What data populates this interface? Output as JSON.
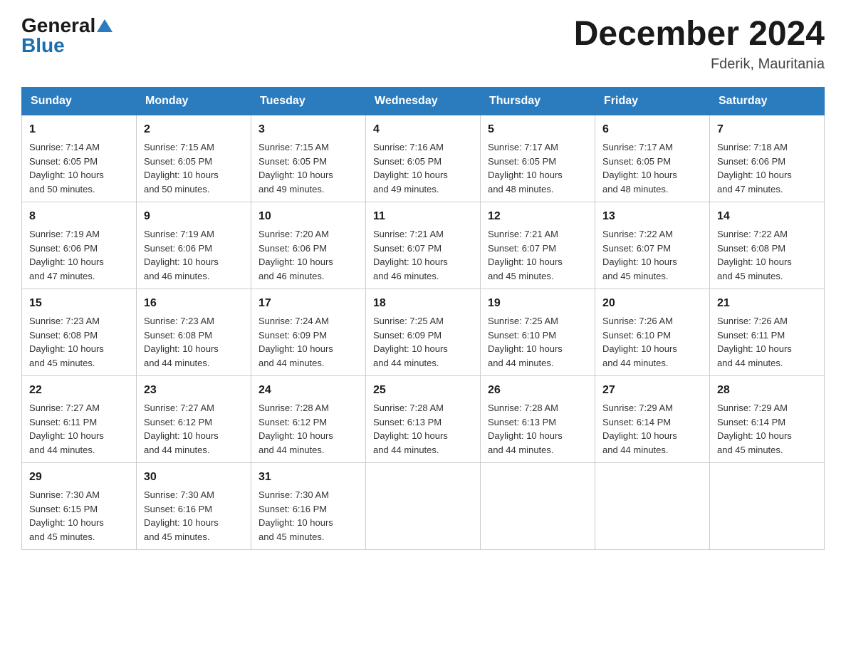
{
  "header": {
    "logo_general": "General",
    "logo_blue": "Blue",
    "month_title": "December 2024",
    "location": "Fderik, Mauritania"
  },
  "days_of_week": [
    "Sunday",
    "Monday",
    "Tuesday",
    "Wednesday",
    "Thursday",
    "Friday",
    "Saturday"
  ],
  "weeks": [
    [
      {
        "day": "1",
        "sunrise": "7:14 AM",
        "sunset": "6:05 PM",
        "daylight": "10 hours and 50 minutes."
      },
      {
        "day": "2",
        "sunrise": "7:15 AM",
        "sunset": "6:05 PM",
        "daylight": "10 hours and 50 minutes."
      },
      {
        "day": "3",
        "sunrise": "7:15 AM",
        "sunset": "6:05 PM",
        "daylight": "10 hours and 49 minutes."
      },
      {
        "day": "4",
        "sunrise": "7:16 AM",
        "sunset": "6:05 PM",
        "daylight": "10 hours and 49 minutes."
      },
      {
        "day": "5",
        "sunrise": "7:17 AM",
        "sunset": "6:05 PM",
        "daylight": "10 hours and 48 minutes."
      },
      {
        "day": "6",
        "sunrise": "7:17 AM",
        "sunset": "6:05 PM",
        "daylight": "10 hours and 48 minutes."
      },
      {
        "day": "7",
        "sunrise": "7:18 AM",
        "sunset": "6:06 PM",
        "daylight": "10 hours and 47 minutes."
      }
    ],
    [
      {
        "day": "8",
        "sunrise": "7:19 AM",
        "sunset": "6:06 PM",
        "daylight": "10 hours and 47 minutes."
      },
      {
        "day": "9",
        "sunrise": "7:19 AM",
        "sunset": "6:06 PM",
        "daylight": "10 hours and 46 minutes."
      },
      {
        "day": "10",
        "sunrise": "7:20 AM",
        "sunset": "6:06 PM",
        "daylight": "10 hours and 46 minutes."
      },
      {
        "day": "11",
        "sunrise": "7:21 AM",
        "sunset": "6:07 PM",
        "daylight": "10 hours and 46 minutes."
      },
      {
        "day": "12",
        "sunrise": "7:21 AM",
        "sunset": "6:07 PM",
        "daylight": "10 hours and 45 minutes."
      },
      {
        "day": "13",
        "sunrise": "7:22 AM",
        "sunset": "6:07 PM",
        "daylight": "10 hours and 45 minutes."
      },
      {
        "day": "14",
        "sunrise": "7:22 AM",
        "sunset": "6:08 PM",
        "daylight": "10 hours and 45 minutes."
      }
    ],
    [
      {
        "day": "15",
        "sunrise": "7:23 AM",
        "sunset": "6:08 PM",
        "daylight": "10 hours and 45 minutes."
      },
      {
        "day": "16",
        "sunrise": "7:23 AM",
        "sunset": "6:08 PM",
        "daylight": "10 hours and 44 minutes."
      },
      {
        "day": "17",
        "sunrise": "7:24 AM",
        "sunset": "6:09 PM",
        "daylight": "10 hours and 44 minutes."
      },
      {
        "day": "18",
        "sunrise": "7:25 AM",
        "sunset": "6:09 PM",
        "daylight": "10 hours and 44 minutes."
      },
      {
        "day": "19",
        "sunrise": "7:25 AM",
        "sunset": "6:10 PM",
        "daylight": "10 hours and 44 minutes."
      },
      {
        "day": "20",
        "sunrise": "7:26 AM",
        "sunset": "6:10 PM",
        "daylight": "10 hours and 44 minutes."
      },
      {
        "day": "21",
        "sunrise": "7:26 AM",
        "sunset": "6:11 PM",
        "daylight": "10 hours and 44 minutes."
      }
    ],
    [
      {
        "day": "22",
        "sunrise": "7:27 AM",
        "sunset": "6:11 PM",
        "daylight": "10 hours and 44 minutes."
      },
      {
        "day": "23",
        "sunrise": "7:27 AM",
        "sunset": "6:12 PM",
        "daylight": "10 hours and 44 minutes."
      },
      {
        "day": "24",
        "sunrise": "7:28 AM",
        "sunset": "6:12 PM",
        "daylight": "10 hours and 44 minutes."
      },
      {
        "day": "25",
        "sunrise": "7:28 AM",
        "sunset": "6:13 PM",
        "daylight": "10 hours and 44 minutes."
      },
      {
        "day": "26",
        "sunrise": "7:28 AM",
        "sunset": "6:13 PM",
        "daylight": "10 hours and 44 minutes."
      },
      {
        "day": "27",
        "sunrise": "7:29 AM",
        "sunset": "6:14 PM",
        "daylight": "10 hours and 44 minutes."
      },
      {
        "day": "28",
        "sunrise": "7:29 AM",
        "sunset": "6:14 PM",
        "daylight": "10 hours and 45 minutes."
      }
    ],
    [
      {
        "day": "29",
        "sunrise": "7:30 AM",
        "sunset": "6:15 PM",
        "daylight": "10 hours and 45 minutes."
      },
      {
        "day": "30",
        "sunrise": "7:30 AM",
        "sunset": "6:16 PM",
        "daylight": "10 hours and 45 minutes."
      },
      {
        "day": "31",
        "sunrise": "7:30 AM",
        "sunset": "6:16 PM",
        "daylight": "10 hours and 45 minutes."
      },
      null,
      null,
      null,
      null
    ]
  ],
  "labels": {
    "sunrise": "Sunrise:",
    "sunset": "Sunset:",
    "daylight": "Daylight:"
  }
}
